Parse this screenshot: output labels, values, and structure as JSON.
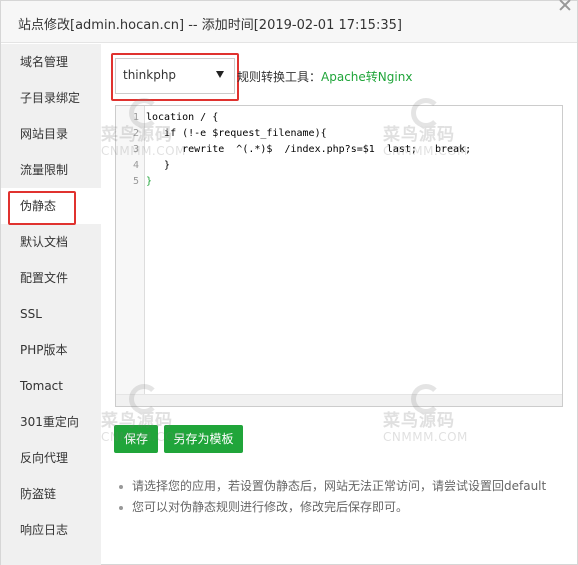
{
  "window": {
    "title": "站点修改[admin.hocan.cn] -- 添加时间[2019-02-01 17:15:35]"
  },
  "sidebar": {
    "items": [
      {
        "label": "域名管理"
      },
      {
        "label": "子目录绑定"
      },
      {
        "label": "网站目录"
      },
      {
        "label": "流量限制"
      },
      {
        "label": "伪静态"
      },
      {
        "label": "默认文档"
      },
      {
        "label": "配置文件"
      },
      {
        "label": "SSL"
      },
      {
        "label": "PHP版本"
      },
      {
        "label": "Tomact"
      },
      {
        "label": "301重定向"
      },
      {
        "label": "反向代理"
      },
      {
        "label": "防盗链"
      },
      {
        "label": "响应日志"
      }
    ],
    "active": "伪静态"
  },
  "rewrite": {
    "selected_rule": "thinkphp",
    "converter_label": "规则转换工具：",
    "converter_link": "Apache转Nginx"
  },
  "editor": {
    "line_numbers": [
      "1",
      "2",
      "3",
      "4",
      "5"
    ],
    "lines": [
      "location / {",
      "   if (!-e $request_filename){",
      "      rewrite  ^(.*)$  /index.php?s=$1  last;   break;",
      "   }",
      "}"
    ]
  },
  "buttons": {
    "save": "保存",
    "save_as_template": "另存为模板"
  },
  "tips": [
    "请选择您的应用，若设置伪静态后，网站无法正常访问，请尝试设置回default",
    "您可以对伪静态规则进行修改，修改完后保存即可。"
  ],
  "watermark": {
    "cn": "菜鸟源码",
    "en": "CNMMM.COM"
  },
  "colors": {
    "accent": "#20a53a",
    "highlight_border": "#e0322f",
    "sidebar_bg": "#f0f0f0"
  }
}
